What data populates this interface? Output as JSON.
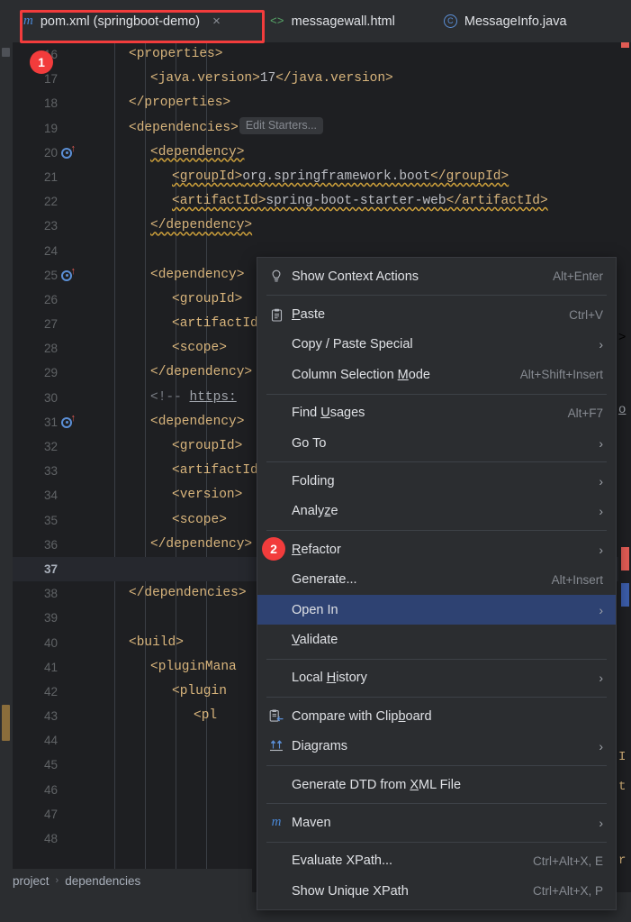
{
  "window": {
    "app": "IntelliJ IDEA",
    "theme_bg": "#1e1f22",
    "accent": "#2e4272",
    "annotation_color": "#f23c3c"
  },
  "tabs": [
    {
      "label": "pom.xml (springboot-demo)",
      "icon": "maven-icon",
      "close": "×",
      "active": true
    },
    {
      "label": "messagewall.html",
      "icon": "html-icon",
      "active": false
    },
    {
      "label": "MessageInfo.java",
      "icon": "java-class-icon",
      "active": false
    }
  ],
  "annotations": [
    {
      "id": "1",
      "target": "pom-xml-tab"
    },
    {
      "id": "2",
      "target": "refactor-menu-item"
    },
    {
      "id": "rect",
      "target": "generate-menu-item"
    }
  ],
  "editor": {
    "inlay_hint": "Edit Starters...",
    "lines": [
      {
        "num": "16",
        "indent": 2,
        "text": "<properties>",
        "kind": "tag",
        "gutter_icon": false
      },
      {
        "num": "17",
        "indent": 3,
        "text": "<java.version>17</java.version>",
        "kind": "tag-value",
        "gutter_icon": false
      },
      {
        "num": "18",
        "indent": 2,
        "text": "</properties>",
        "kind": "tag",
        "gutter_icon": false
      },
      {
        "num": "19",
        "indent": 2,
        "text": "<dependencies>",
        "kind": "tag-inlay",
        "gutter_icon": false
      },
      {
        "num": "20",
        "indent": 3,
        "text": "<dependency>",
        "kind": "tag-warn",
        "gutter_icon": true
      },
      {
        "num": "21",
        "indent": 4,
        "text": "<groupId>org.springframework.boot</groupId>",
        "kind": "tag-value-warn",
        "gutter_icon": false
      },
      {
        "num": "22",
        "indent": 4,
        "text": "<artifactId>spring-boot-starter-web</artifactId>",
        "kind": "tag-value-warn",
        "gutter_icon": false
      },
      {
        "num": "23",
        "indent": 3,
        "text": "</dependency>",
        "kind": "tag-warn",
        "gutter_icon": false
      },
      {
        "num": "24",
        "indent": 0,
        "text": "",
        "kind": "blank",
        "gutter_icon": false
      },
      {
        "num": "25",
        "indent": 3,
        "text": "<dependency>",
        "kind": "tag",
        "gutter_icon": true
      },
      {
        "num": "26",
        "indent": 4,
        "text": "<groupId>",
        "kind": "tag",
        "gutter_icon": false
      },
      {
        "num": "27",
        "indent": 4,
        "text": "<artifactId>",
        "kind": "tag",
        "gutter_icon": false
      },
      {
        "num": "28",
        "indent": 4,
        "text": "<scope>",
        "kind": "tag",
        "gutter_icon": false
      },
      {
        "num": "29",
        "indent": 3,
        "text": "</dependency>",
        "kind": "tag",
        "gutter_icon": false
      },
      {
        "num": "30",
        "indent": 3,
        "text": "<!-- https:",
        "kind": "comment-link",
        "gutter_icon": false
      },
      {
        "num": "31",
        "indent": 3,
        "text": "<dependency>",
        "kind": "tag",
        "gutter_icon": true
      },
      {
        "num": "32",
        "indent": 4,
        "text": "<groupId>",
        "kind": "tag",
        "gutter_icon": false
      },
      {
        "num": "33",
        "indent": 4,
        "text": "<artifactId>",
        "kind": "tag",
        "gutter_icon": false
      },
      {
        "num": "34",
        "indent": 4,
        "text": "<version>",
        "kind": "tag",
        "gutter_icon": false
      },
      {
        "num": "35",
        "indent": 4,
        "text": "<scope>",
        "kind": "tag",
        "gutter_icon": false
      },
      {
        "num": "36",
        "indent": 3,
        "text": "</dependency>",
        "kind": "tag",
        "gutter_icon": false
      },
      {
        "num": "37",
        "indent": 0,
        "text": "",
        "kind": "blank-current",
        "gutter_icon": false
      },
      {
        "num": "38",
        "indent": 2,
        "text": "</dependencies>",
        "kind": "tag",
        "gutter_icon": false
      },
      {
        "num": "39",
        "indent": 0,
        "text": "",
        "kind": "blank",
        "gutter_icon": false
      },
      {
        "num": "40",
        "indent": 2,
        "text": "<build>",
        "kind": "tag",
        "gutter_icon": false
      },
      {
        "num": "41",
        "indent": 3,
        "text": "<pluginMana",
        "kind": "tag",
        "gutter_icon": false
      },
      {
        "num": "42",
        "indent": 4,
        "text": "<plugin",
        "kind": "tag",
        "gutter_icon": false
      },
      {
        "num": "43",
        "indent": 5,
        "text": "<pl",
        "kind": "tag",
        "gutter_icon": false
      },
      {
        "num": "44",
        "indent": 0,
        "text": "",
        "kind": "blank",
        "gutter_icon": false
      },
      {
        "num": "45",
        "indent": 0,
        "text": "",
        "kind": "blank",
        "gutter_icon": false
      },
      {
        "num": "46",
        "indent": 0,
        "text": "",
        "kind": "blank",
        "gutter_icon": false
      },
      {
        "num": "47",
        "indent": 0,
        "text": "",
        "kind": "blank",
        "gutter_icon": false
      },
      {
        "num": "48",
        "indent": 0,
        "text": "",
        "kind": "blank",
        "gutter_icon": false
      }
    ],
    "peek_right": [
      {
        "text": ">",
        "color": "#d9b57c"
      },
      {
        "text": "o",
        "color": "#a0a4ab"
      },
      {
        "text": "I",
        "color": "#d9b57c"
      },
      {
        "text": "t",
        "color": "#d9b57c"
      },
      {
        "text": "r",
        "color": "#d9b57c"
      }
    ]
  },
  "breadcrumb": {
    "items": [
      "project",
      "dependencies"
    ],
    "separator": "›"
  },
  "context_menu": {
    "items": [
      {
        "type": "item",
        "label": "Show Context Actions",
        "accel": "Alt+Enter",
        "icon": "lightbulb-icon",
        "arrow": false,
        "selected": false
      },
      {
        "type": "separator"
      },
      {
        "type": "item",
        "label": "Paste",
        "mnemonic": "P",
        "accel": "Ctrl+V",
        "icon": "clipboard-icon",
        "arrow": false,
        "selected": false
      },
      {
        "type": "item",
        "label": "Copy / Paste Special",
        "accel": "",
        "icon": "",
        "arrow": true,
        "selected": false
      },
      {
        "type": "item",
        "label": "Column Selection Mode",
        "mnemonic": "M",
        "accel": "Alt+Shift+Insert",
        "icon": "",
        "arrow": false,
        "selected": false
      },
      {
        "type": "separator"
      },
      {
        "type": "item",
        "label": "Find Usages",
        "mnemonic": "U",
        "accel": "Alt+F7",
        "icon": "",
        "arrow": false,
        "selected": false
      },
      {
        "type": "item",
        "label": "Go To",
        "accel": "",
        "icon": "",
        "arrow": true,
        "selected": false
      },
      {
        "type": "separator"
      },
      {
        "type": "item",
        "label": "Folding",
        "accel": "",
        "icon": "",
        "arrow": true,
        "selected": false
      },
      {
        "type": "item",
        "label": "Analyze",
        "mnemonic": "z",
        "accel": "",
        "icon": "",
        "arrow": true,
        "selected": false
      },
      {
        "type": "separator"
      },
      {
        "type": "item",
        "label": "Refactor",
        "mnemonic": "R",
        "accel": "",
        "icon": "",
        "arrow": true,
        "selected": false
      },
      {
        "type": "item",
        "label": "Generate...",
        "accel": "Alt+Insert",
        "icon": "",
        "arrow": false,
        "selected": false,
        "highlighted_rect": true
      },
      {
        "type": "item",
        "label": "Open In",
        "accel": "",
        "icon": "",
        "arrow": true,
        "selected": true
      },
      {
        "type": "item",
        "label": "Validate",
        "mnemonic": "V",
        "accel": "",
        "icon": "",
        "arrow": false,
        "selected": false
      },
      {
        "type": "separator"
      },
      {
        "type": "item",
        "label": "Local History",
        "mnemonic": "H",
        "accel": "",
        "icon": "",
        "arrow": true,
        "selected": false
      },
      {
        "type": "separator"
      },
      {
        "type": "item",
        "label": "Compare with Clipboard",
        "mnemonic": "b",
        "accel": "",
        "icon": "compare-clipboard-icon",
        "arrow": false,
        "selected": false
      },
      {
        "type": "item",
        "label": "Diagrams",
        "accel": "",
        "icon": "diagrams-icon",
        "arrow": true,
        "selected": false
      },
      {
        "type": "separator"
      },
      {
        "type": "item",
        "label": "Generate DTD from XML File",
        "mnemonic": "X",
        "accel": "",
        "icon": "",
        "arrow": false,
        "selected": false
      },
      {
        "type": "separator"
      },
      {
        "type": "item",
        "label": "Maven",
        "accel": "",
        "icon": "maven-icon",
        "arrow": true,
        "selected": false
      },
      {
        "type": "separator"
      },
      {
        "type": "item",
        "label": "Evaluate XPath...",
        "accel": "Ctrl+Alt+X, E",
        "icon": "",
        "arrow": false,
        "selected": false
      },
      {
        "type": "item",
        "label": "Show Unique XPath",
        "accel": "Ctrl+Alt+X, P",
        "icon": "",
        "arrow": false,
        "selected": false
      }
    ]
  }
}
